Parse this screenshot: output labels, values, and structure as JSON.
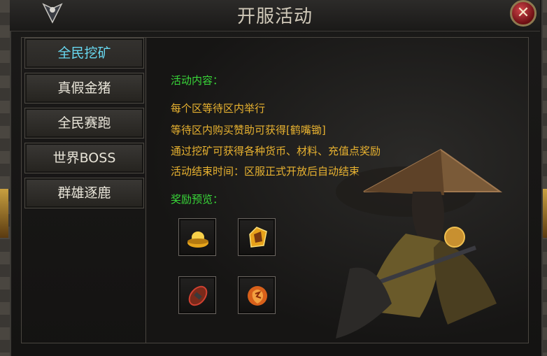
{
  "window": {
    "title": "开服活动"
  },
  "tabs": [
    {
      "label": "全民挖矿",
      "active": true
    },
    {
      "label": "真假金猪",
      "active": false
    },
    {
      "label": "全民赛跑",
      "active": false
    },
    {
      "label": "世界BOSS",
      "active": false
    },
    {
      "label": "群雄逐鹿",
      "active": false
    }
  ],
  "activity": {
    "content_heading": "活动内容：",
    "lines": [
      "每个区等待区内举行",
      "等待区内购买赞助可获得[鹤嘴锄]",
      "通过挖矿可获得各种货币、材料、充值点奖励",
      "活动结束时间：区服正式开放后自动结束"
    ],
    "reward_heading": "奖励预览："
  },
  "rewards": [
    {
      "icon": "gold-ingot-icon"
    },
    {
      "icon": "gem-crystal-icon"
    },
    {
      "icon": "rune-stone-icon"
    },
    {
      "icon": "fire-token-icon"
    }
  ],
  "colors": {
    "active_tab": "#68d8f0",
    "heading_green": "#39d839",
    "text_orange": "#e8b230"
  }
}
